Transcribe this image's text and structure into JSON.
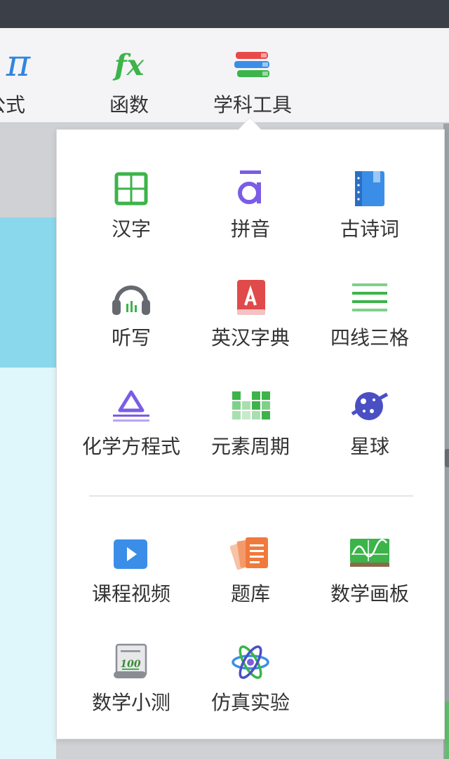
{
  "toolbar": {
    "formula": {
      "label": "公式",
      "icon": "pi-icon"
    },
    "function": {
      "label": "函数",
      "icon": "fx-icon"
    },
    "subject_tools": {
      "label": "学科工具",
      "icon": "books-stack-icon"
    }
  },
  "popup": {
    "items": [
      {
        "label": "汉字",
        "icon": "chinese-character-grid-icon"
      },
      {
        "label": "拼音",
        "icon": "pinyin-a-icon"
      },
      {
        "label": "古诗词",
        "icon": "poetry-book-icon"
      },
      {
        "label": "听写",
        "icon": "headphones-icon"
      },
      {
        "label": "英汉字典",
        "icon": "dictionary-icon"
      },
      {
        "label": "四线三格",
        "icon": "four-lines-icon"
      },
      {
        "label": "化学方程式",
        "icon": "chemical-equation-icon"
      },
      {
        "label": "元素周期",
        "icon": "periodic-table-icon"
      },
      {
        "label": "星球",
        "icon": "planet-icon"
      },
      {
        "label": "课程视频",
        "icon": "course-video-icon"
      },
      {
        "label": "题库",
        "icon": "question-bank-icon"
      },
      {
        "label": "数学画板",
        "icon": "math-board-icon"
      },
      {
        "label": "数学小测",
        "icon": "math-quiz-icon"
      },
      {
        "label": "仿真实验",
        "icon": "simulation-atom-icon"
      }
    ]
  },
  "colors": {
    "green": "#3cb44a",
    "purple": "#7b5ce6",
    "blue": "#3b8ee8",
    "red": "#e04a4a",
    "orange": "#f07a3c"
  }
}
